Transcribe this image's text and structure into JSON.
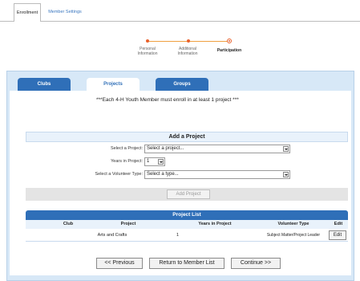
{
  "top_tabs": {
    "enrollment": "Enrollment",
    "member_settings": "Member Settings"
  },
  "steps": [
    {
      "label": "Personal\nInformation"
    },
    {
      "label": "Additional\nInformation"
    },
    {
      "label": "Participation"
    }
  ],
  "tabs": {
    "clubs": "Clubs",
    "projects": "Projects",
    "groups": "Groups"
  },
  "notice": "***Each 4-H Youth Member must enroll in at least 1 project ***",
  "add_project": {
    "title": "Add a Project",
    "project_label": "Select a Project:",
    "project_value": "Select a project...",
    "years_label": "Years in Project:",
    "years_value": "1",
    "volunteer_label": "Select a Volunteer Type:",
    "volunteer_value": "Select a type...",
    "button": "Add Project"
  },
  "project_list": {
    "title": "Project List",
    "columns": [
      "Club",
      "Project",
      "Years in Project",
      "Volunteer Type",
      "Edit"
    ],
    "rows": [
      {
        "club": "",
        "project": "Arts and Crafts",
        "years": "1",
        "volunteer": "Subject Matter/Project Leader",
        "edit": "Edit"
      }
    ]
  },
  "nav": {
    "previous": "<< Previous",
    "return": "Return to Member List",
    "continue": "Continue >>"
  },
  "colors": {
    "accent": "#2f6fb8",
    "panel": "#d7e8f7",
    "step": "#e8602c"
  }
}
